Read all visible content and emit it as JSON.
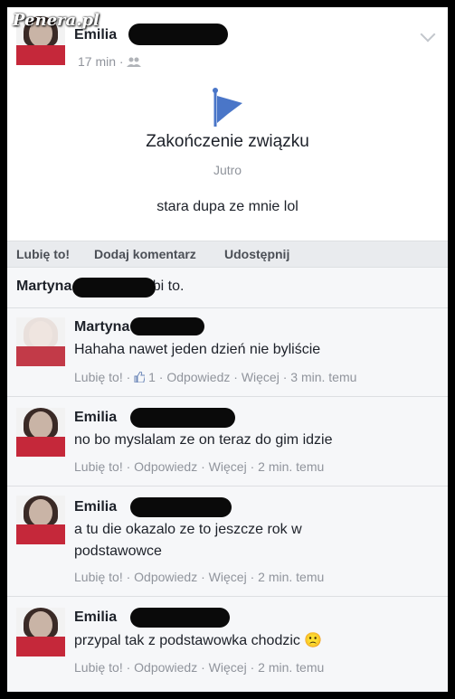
{
  "watermark": "Penera.pl",
  "post": {
    "author": "Emilia",
    "time": "17 min",
    "privacy_icon": "friends-icon",
    "life_event_icon": "flag-icon",
    "life_event_title": "Zakończenie związku",
    "life_event_date": "Jutro",
    "text": "stara dupa ze mnie lol",
    "actions": {
      "like": "Lubię to!",
      "comment": "Dodaj komentarz",
      "share": "Udostępnij"
    }
  },
  "likes": {
    "name": "Martyna",
    "suffix": "lubi to."
  },
  "comments": [
    {
      "author": "Martyna",
      "text": "Hahaha nawet jeden dzień nie byliście",
      "like": "Lubię to!",
      "like_icon": "thumbs-up-icon",
      "like_count": "1",
      "reply": "Odpowiedz",
      "more": "Więcej",
      "time": "3 min. temu"
    },
    {
      "author": "Emilia",
      "text": "no bo myslalam ze on teraz do gim idzie",
      "like": "Lubię to!",
      "reply": "Odpowiedz",
      "more": "Więcej",
      "time": "2 min. temu"
    },
    {
      "author": "Emilia",
      "text": "a tu die okazalo ze to jeszcze rok w podstawowce",
      "like": "Lubię to!",
      "reply": "Odpowiedz",
      "more": "Więcej",
      "time": "2 min. temu"
    },
    {
      "author": "Emilia",
      "text": "przypal tak z podstawowka chodzic",
      "emoji": "🙁",
      "like": "Lubię to!",
      "reply": "Odpowiedz",
      "more": "Więcej",
      "time": "2 min. temu"
    }
  ],
  "colors": {
    "flag": "#4a76c8",
    "meta": "#90949c",
    "redaction": "#0a0a0a"
  }
}
